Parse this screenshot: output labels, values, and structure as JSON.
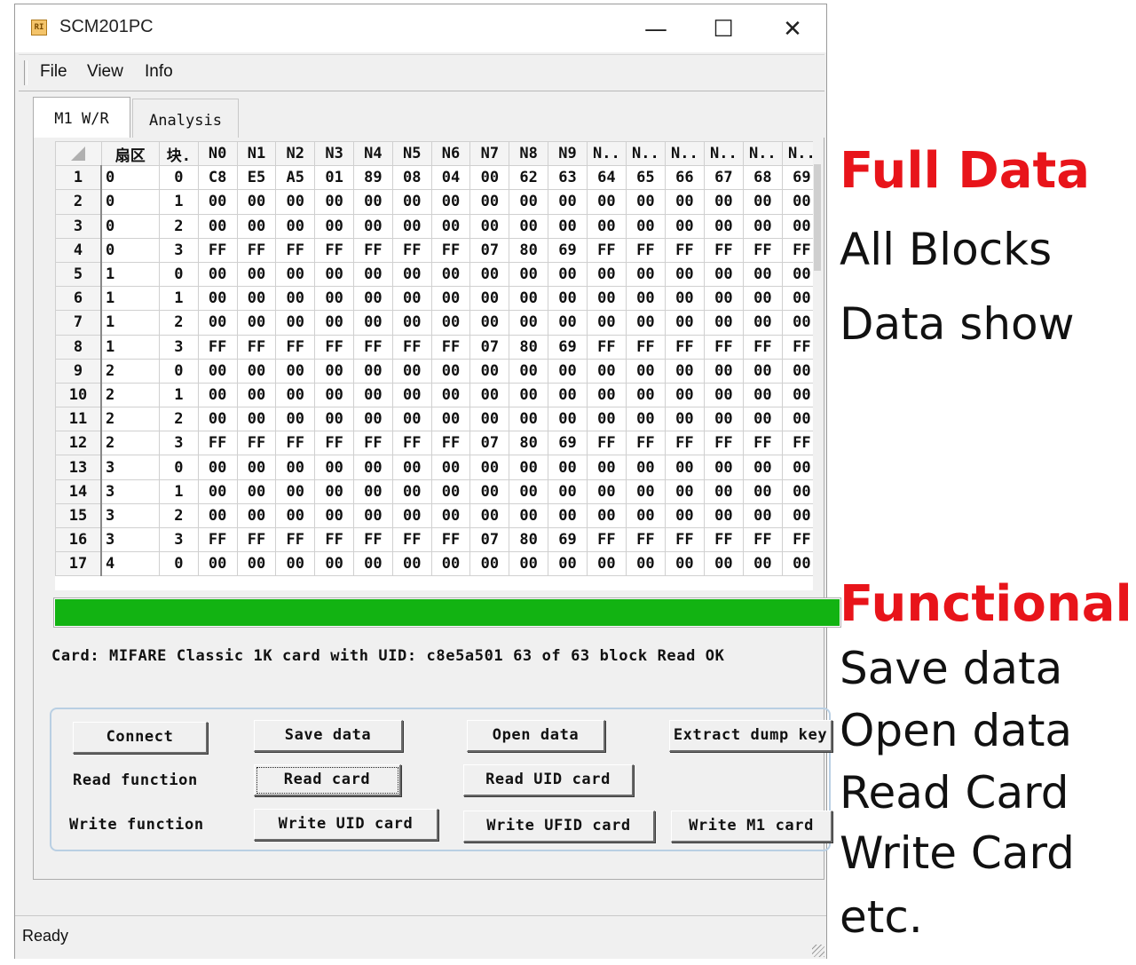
{
  "window": {
    "icon_text": "RI",
    "title": "SCM201PC",
    "minimize": "—",
    "maximize": "☐",
    "close": "✕"
  },
  "menu": {
    "items": [
      "File",
      "View",
      "Info"
    ]
  },
  "tabs": [
    "M1 W/R",
    "Analysis"
  ],
  "grid": {
    "headers": [
      "扇区",
      "块.",
      "N0",
      "N1",
      "N2",
      "N3",
      "N4",
      "N5",
      "N6",
      "N7",
      "N8",
      "N9",
      "N..",
      "N..",
      "N..",
      "N..",
      "N..",
      "N.."
    ],
    "rows": [
      {
        "num": "1",
        "sector": "0",
        "block": "0",
        "data": [
          "C8",
          "E5",
          "A5",
          "01",
          "89",
          "08",
          "04",
          "00",
          "62",
          "63",
          "64",
          "65",
          "66",
          "67",
          "68",
          "69"
        ]
      },
      {
        "num": "2",
        "sector": "0",
        "block": "1",
        "data": [
          "00",
          "00",
          "00",
          "00",
          "00",
          "00",
          "00",
          "00",
          "00",
          "00",
          "00",
          "00",
          "00",
          "00",
          "00",
          "00"
        ]
      },
      {
        "num": "3",
        "sector": "0",
        "block": "2",
        "data": [
          "00",
          "00",
          "00",
          "00",
          "00",
          "00",
          "00",
          "00",
          "00",
          "00",
          "00",
          "00",
          "00",
          "00",
          "00",
          "00"
        ]
      },
      {
        "num": "4",
        "sector": "0",
        "block": "3",
        "data": [
          "FF",
          "FF",
          "FF",
          "FF",
          "FF",
          "FF",
          "FF",
          "07",
          "80",
          "69",
          "FF",
          "FF",
          "FF",
          "FF",
          "FF",
          "FF"
        ]
      },
      {
        "num": "5",
        "sector": "1",
        "block": "0",
        "data": [
          "00",
          "00",
          "00",
          "00",
          "00",
          "00",
          "00",
          "00",
          "00",
          "00",
          "00",
          "00",
          "00",
          "00",
          "00",
          "00"
        ]
      },
      {
        "num": "6",
        "sector": "1",
        "block": "1",
        "data": [
          "00",
          "00",
          "00",
          "00",
          "00",
          "00",
          "00",
          "00",
          "00",
          "00",
          "00",
          "00",
          "00",
          "00",
          "00",
          "00"
        ]
      },
      {
        "num": "7",
        "sector": "1",
        "block": "2",
        "data": [
          "00",
          "00",
          "00",
          "00",
          "00",
          "00",
          "00",
          "00",
          "00",
          "00",
          "00",
          "00",
          "00",
          "00",
          "00",
          "00"
        ]
      },
      {
        "num": "8",
        "sector": "1",
        "block": "3",
        "data": [
          "FF",
          "FF",
          "FF",
          "FF",
          "FF",
          "FF",
          "FF",
          "07",
          "80",
          "69",
          "FF",
          "FF",
          "FF",
          "FF",
          "FF",
          "FF"
        ]
      },
      {
        "num": "9",
        "sector": "2",
        "block": "0",
        "data": [
          "00",
          "00",
          "00",
          "00",
          "00",
          "00",
          "00",
          "00",
          "00",
          "00",
          "00",
          "00",
          "00",
          "00",
          "00",
          "00"
        ]
      },
      {
        "num": "10",
        "sector": "2",
        "block": "1",
        "data": [
          "00",
          "00",
          "00",
          "00",
          "00",
          "00",
          "00",
          "00",
          "00",
          "00",
          "00",
          "00",
          "00",
          "00",
          "00",
          "00"
        ]
      },
      {
        "num": "11",
        "sector": "2",
        "block": "2",
        "data": [
          "00",
          "00",
          "00",
          "00",
          "00",
          "00",
          "00",
          "00",
          "00",
          "00",
          "00",
          "00",
          "00",
          "00",
          "00",
          "00"
        ]
      },
      {
        "num": "12",
        "sector": "2",
        "block": "3",
        "data": [
          "FF",
          "FF",
          "FF",
          "FF",
          "FF",
          "FF",
          "FF",
          "07",
          "80",
          "69",
          "FF",
          "FF",
          "FF",
          "FF",
          "FF",
          "FF"
        ]
      },
      {
        "num": "13",
        "sector": "3",
        "block": "0",
        "data": [
          "00",
          "00",
          "00",
          "00",
          "00",
          "00",
          "00",
          "00",
          "00",
          "00",
          "00",
          "00",
          "00",
          "00",
          "00",
          "00"
        ]
      },
      {
        "num": "14",
        "sector": "3",
        "block": "1",
        "data": [
          "00",
          "00",
          "00",
          "00",
          "00",
          "00",
          "00",
          "00",
          "00",
          "00",
          "00",
          "00",
          "00",
          "00",
          "00",
          "00"
        ]
      },
      {
        "num": "15",
        "sector": "3",
        "block": "2",
        "data": [
          "00",
          "00",
          "00",
          "00",
          "00",
          "00",
          "00",
          "00",
          "00",
          "00",
          "00",
          "00",
          "00",
          "00",
          "00",
          "00"
        ]
      },
      {
        "num": "16",
        "sector": "3",
        "block": "3",
        "data": [
          "FF",
          "FF",
          "FF",
          "FF",
          "FF",
          "FF",
          "FF",
          "07",
          "80",
          "69",
          "FF",
          "FF",
          "FF",
          "FF",
          "FF",
          "FF"
        ]
      },
      {
        "num": "17",
        "sector": "4",
        "block": "0",
        "data": [
          "00",
          "00",
          "00",
          "00",
          "00",
          "00",
          "00",
          "00",
          "00",
          "00",
          "00",
          "00",
          "00",
          "00",
          "00",
          "00"
        ]
      }
    ]
  },
  "progress": {
    "value": 1.0,
    "color": "#12b312"
  },
  "status_message": "Card: MIFARE Classic 1K card with UID: c8e5a501 63 of 63 block Read OK",
  "buttons": {
    "connect": "Connect",
    "save_data": "Save data",
    "open_data": "Open data",
    "extract_dump_key": "Extract dump key",
    "read_card": "Read card",
    "read_uid_card": "Read UID card",
    "write_uid_card": "Write UID card",
    "write_ufid_card": "Write UFID card",
    "write_m1_card": "Write M1 card"
  },
  "labels": {
    "read_function": "Read function",
    "write_function": "Write function"
  },
  "statusbar": {
    "text": "Ready"
  },
  "captions": {
    "full_data": "Full Data",
    "all_blocks": "All Blocks",
    "data_show": "Data show",
    "functional": "Functional",
    "save_data": "Save data",
    "open_data": "Open data",
    "read_card": "Read Card",
    "write_card": "Write Card",
    "etc": "etc."
  },
  "colors": {
    "caption_heading": "#e8141a",
    "progress_fill": "#12b312",
    "groupbox_border": "#b9cfe3"
  }
}
